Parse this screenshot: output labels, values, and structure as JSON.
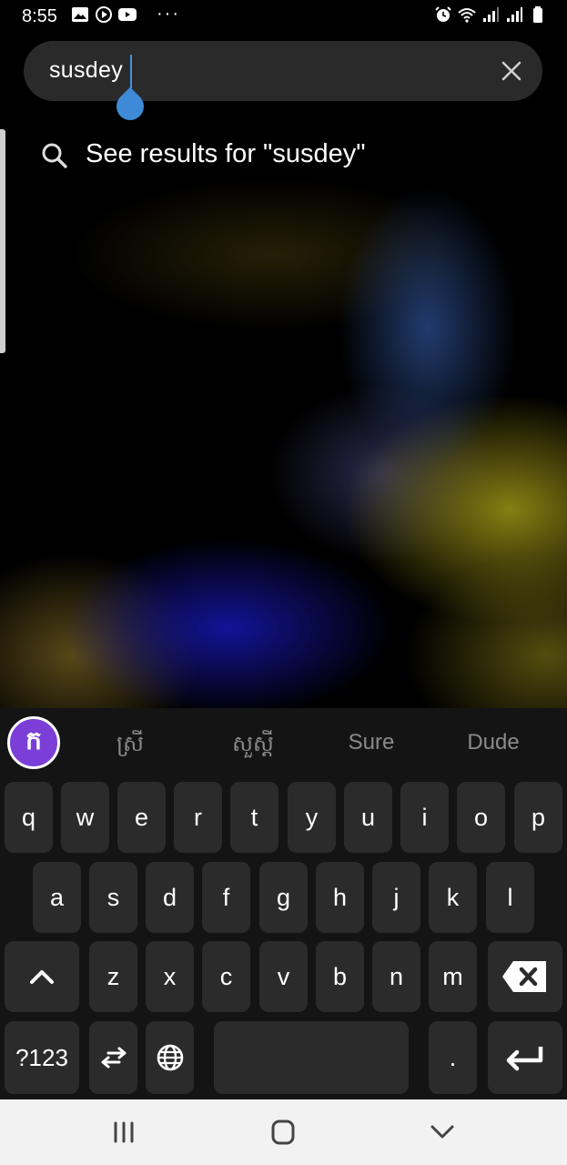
{
  "status_bar": {
    "time": "8:55",
    "left_icons": [
      "gallery-icon",
      "play-circle-icon",
      "youtube-icon"
    ],
    "more_dots": "···",
    "right_icons": [
      "alarm-icon",
      "wifi-icon",
      "signal-icon",
      "signal-icon",
      "battery-icon"
    ]
  },
  "search": {
    "query": "susdey",
    "clear_icon": "close-icon"
  },
  "suggestion": {
    "icon": "search-icon",
    "label": "See results for \"susdey\""
  },
  "keyboard": {
    "logo_glyph": "ក",
    "predictions": [
      "ស្រី",
      "សួស្តី",
      "Sure",
      "Dude"
    ],
    "rows": [
      [
        "q",
        "w",
        "e",
        "r",
        "t",
        "y",
        "u",
        "i",
        "o",
        "p"
      ],
      [
        "a",
        "s",
        "d",
        "f",
        "g",
        "h",
        "j",
        "k",
        "l"
      ],
      [
        "z",
        "x",
        "c",
        "v",
        "b",
        "n",
        "m"
      ]
    ],
    "symbols_label": "?123",
    "period_label": ".",
    "shift_icon": "chevron-up-icon",
    "backspace_icon": "backspace-icon",
    "switch_icon": "swap-arrows-icon",
    "language_icon": "globe-icon",
    "enter_icon": "enter-icon"
  },
  "nav_bar": {
    "recents_icon": "recents-icon",
    "home_icon": "home-icon",
    "back_icon": "chevron-down-icon"
  },
  "colors": {
    "caret": "#3e8ad6",
    "logo": "#7b3fd8",
    "key_bg": "#2b2b2b"
  }
}
